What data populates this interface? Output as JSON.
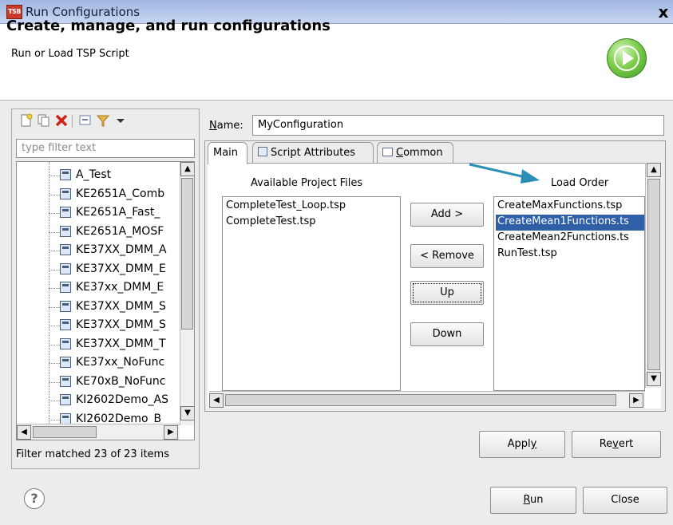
{
  "window": {
    "title": "Run Configurations",
    "app_icon_text": "TSB",
    "close_glyph": "x"
  },
  "banner": {
    "title": "Create, manage, and run configurations",
    "subtitle": "Run or Load TSP Script",
    "icon": "run-icon"
  },
  "left_panel": {
    "toolbar_icons": [
      "new-config-icon",
      "duplicate-icon",
      "delete-icon",
      "collapse-all-icon",
      "filter-icon",
      "dropdown-arrow-icon"
    ],
    "filter_placeholder": "type filter text",
    "tree_items": [
      "A_Test",
      "KE2651A_Comb",
      "KE2651A_Fast_",
      "KE2651A_MOSF",
      "KE37XX_DMM_A",
      "KE37XX_DMM_E",
      "KE37xx_DMM_E",
      "KE37XX_DMM_S",
      "KE37XX_DMM_S",
      "KE37XX_DMM_T",
      "KE37xx_NoFunc",
      "KE70xB_NoFunc",
      "KI2602Demo_AS",
      "KI2602Demo_B"
    ],
    "filter_status": "Filter matched 23 of 23 items"
  },
  "name": {
    "label": "Name:",
    "value": "MyConfiguration"
  },
  "tabs": [
    {
      "label": "Main",
      "icon": ""
    },
    {
      "label": "Script Attributes",
      "icon": "script-icon"
    },
    {
      "label": "Common",
      "icon": "common-icon"
    }
  ],
  "main_tab": {
    "available_header": "Available Project Files",
    "available_files": [
      "CompleteTest_Loop.tsp",
      "CompleteTest.tsp"
    ],
    "load_order_header": "Load Order",
    "load_order_files": [
      "CreateMaxFunctions.tsp",
      "CreateMean1Functions.ts",
      "CreateMean2Functions.ts",
      "RunTest.tsp"
    ],
    "selected_load_order_index": 1,
    "buttons": {
      "add": "Add >",
      "remove": "< Remove",
      "up": "Up",
      "down": "Down"
    }
  },
  "actions": {
    "apply": "Apply",
    "revert": "Revert",
    "run": "Run",
    "close": "Close",
    "help": "?"
  },
  "colors": {
    "selection": "#2f5fa7",
    "arrow": "#2a8fb5"
  }
}
